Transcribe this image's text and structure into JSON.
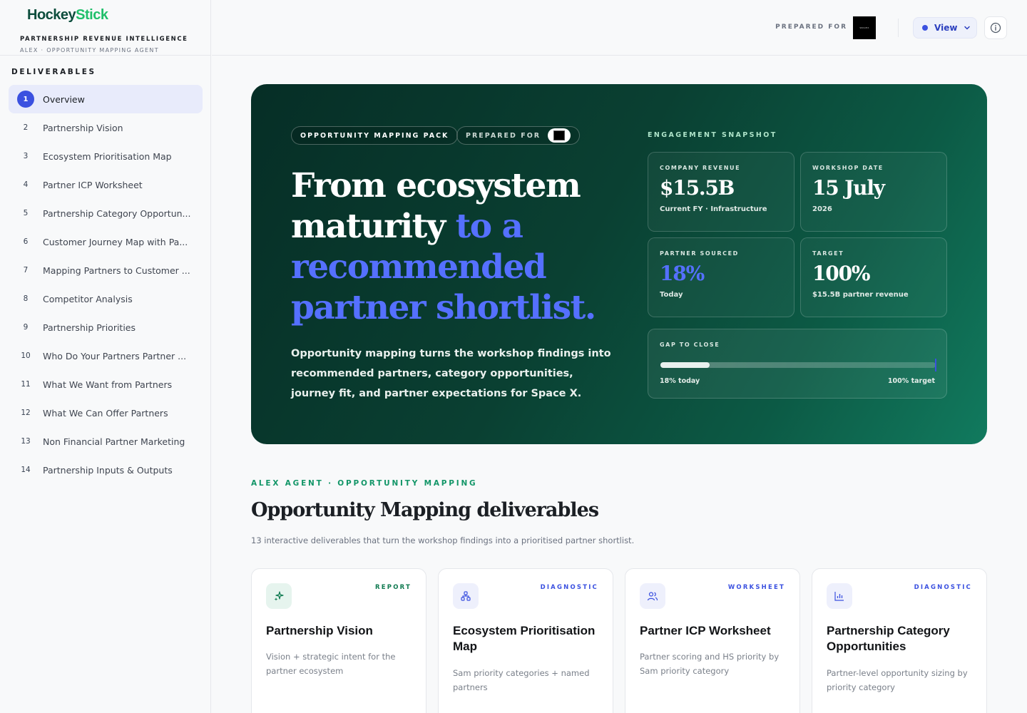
{
  "brand": {
    "logo_part1": "Hockey",
    "logo_part2": "Stick",
    "subtitle": "PARTNERSHIP REVENUE INTELLIGENCE",
    "agent_line": "ALEX · OPPORTUNITY MAPPING AGENT"
  },
  "sidebar": {
    "title": "DELIVERABLES",
    "items": [
      {
        "num": "1",
        "label": "Overview"
      },
      {
        "num": "2",
        "label": "Partnership Vision"
      },
      {
        "num": "3",
        "label": "Ecosystem Prioritisation Map"
      },
      {
        "num": "4",
        "label": "Partner ICP Worksheet"
      },
      {
        "num": "5",
        "label": "Partnership Category Opportun..."
      },
      {
        "num": "6",
        "label": "Customer Journey Map with Pa..."
      },
      {
        "num": "7",
        "label": "Mapping Partners to Customer ..."
      },
      {
        "num": "8",
        "label": "Competitor Analysis"
      },
      {
        "num": "9",
        "label": "Partnership Priorities"
      },
      {
        "num": "10",
        "label": "Who Do Your Partners Partner ..."
      },
      {
        "num": "11",
        "label": "What We Want from Partners"
      },
      {
        "num": "12",
        "label": "What We Can Offer Partners"
      },
      {
        "num": "13",
        "label": "Non Financial Partner Marketing"
      },
      {
        "num": "14",
        "label": "Partnership Inputs & Outputs"
      }
    ]
  },
  "topbar": {
    "prepared_label": "PREPARED FOR",
    "client_logo_text": "SPACEX",
    "view_label": "View"
  },
  "hero": {
    "pill1": "OPPORTUNITY MAPPING PACK",
    "pill2": "PREPARED FOR",
    "title_line1": "From ecosystem",
    "title_line2a": "maturity",
    "title_line2b": "to a",
    "title_line3": "recommended",
    "title_line4": "partner shortlist.",
    "description": "Opportunity mapping turns the workshop findings into recommended partners, category opportunities, journey fit, and partner expectations for Space X.",
    "snapshot_title": "ENGAGEMENT SNAPSHOT",
    "stats": [
      {
        "label": "COMPANY REVENUE",
        "value": "$15.5B",
        "sub": "Current FY · Infrastructure"
      },
      {
        "label": "WORKSHOP DATE",
        "value": "15 July",
        "sub": "2026"
      },
      {
        "label": "PARTNER SOURCED",
        "value": "18%",
        "sub": "Today"
      },
      {
        "label": "TARGET",
        "value": "100%",
        "sub": "$15.5B partner revenue"
      }
    ],
    "gap": {
      "label": "GAP TO CLOSE",
      "current_fraction": 0.18,
      "left_text": "18% today",
      "right_text": "100% target"
    }
  },
  "section": {
    "eyebrow": "ALEX AGENT · OPPORTUNITY MAPPING",
    "title": "Opportunity Mapping deliverables",
    "subtitle": "13 interactive deliverables that turn the workshop findings into a prioritised partner shortlist."
  },
  "cards": [
    {
      "tag": "REPORT",
      "title": "Partnership Vision",
      "desc": "Vision + strategic intent for the partner ecosystem",
      "icon": "sparkles-icon"
    },
    {
      "tag": "DIAGNOSTIC",
      "title": "Ecosystem Prioritisation Map",
      "desc": "Sam priority categories + named partners",
      "icon": "network-icon"
    },
    {
      "tag": "WORKSHEET",
      "title": "Partner ICP Worksheet",
      "desc": "Partner scoring and HS priority by Sam priority category",
      "icon": "users-icon"
    },
    {
      "tag": "DIAGNOSTIC",
      "title": "Partnership Category Opportunities",
      "desc": "Partner-level opportunity sizing by priority category",
      "icon": "bar-chart-icon"
    }
  ],
  "colors": {
    "accent_blue": "#3b51e0",
    "brand_green": "#1fbf6a",
    "hero_dark": "#062e26",
    "eyebrow_green": "#139668"
  }
}
